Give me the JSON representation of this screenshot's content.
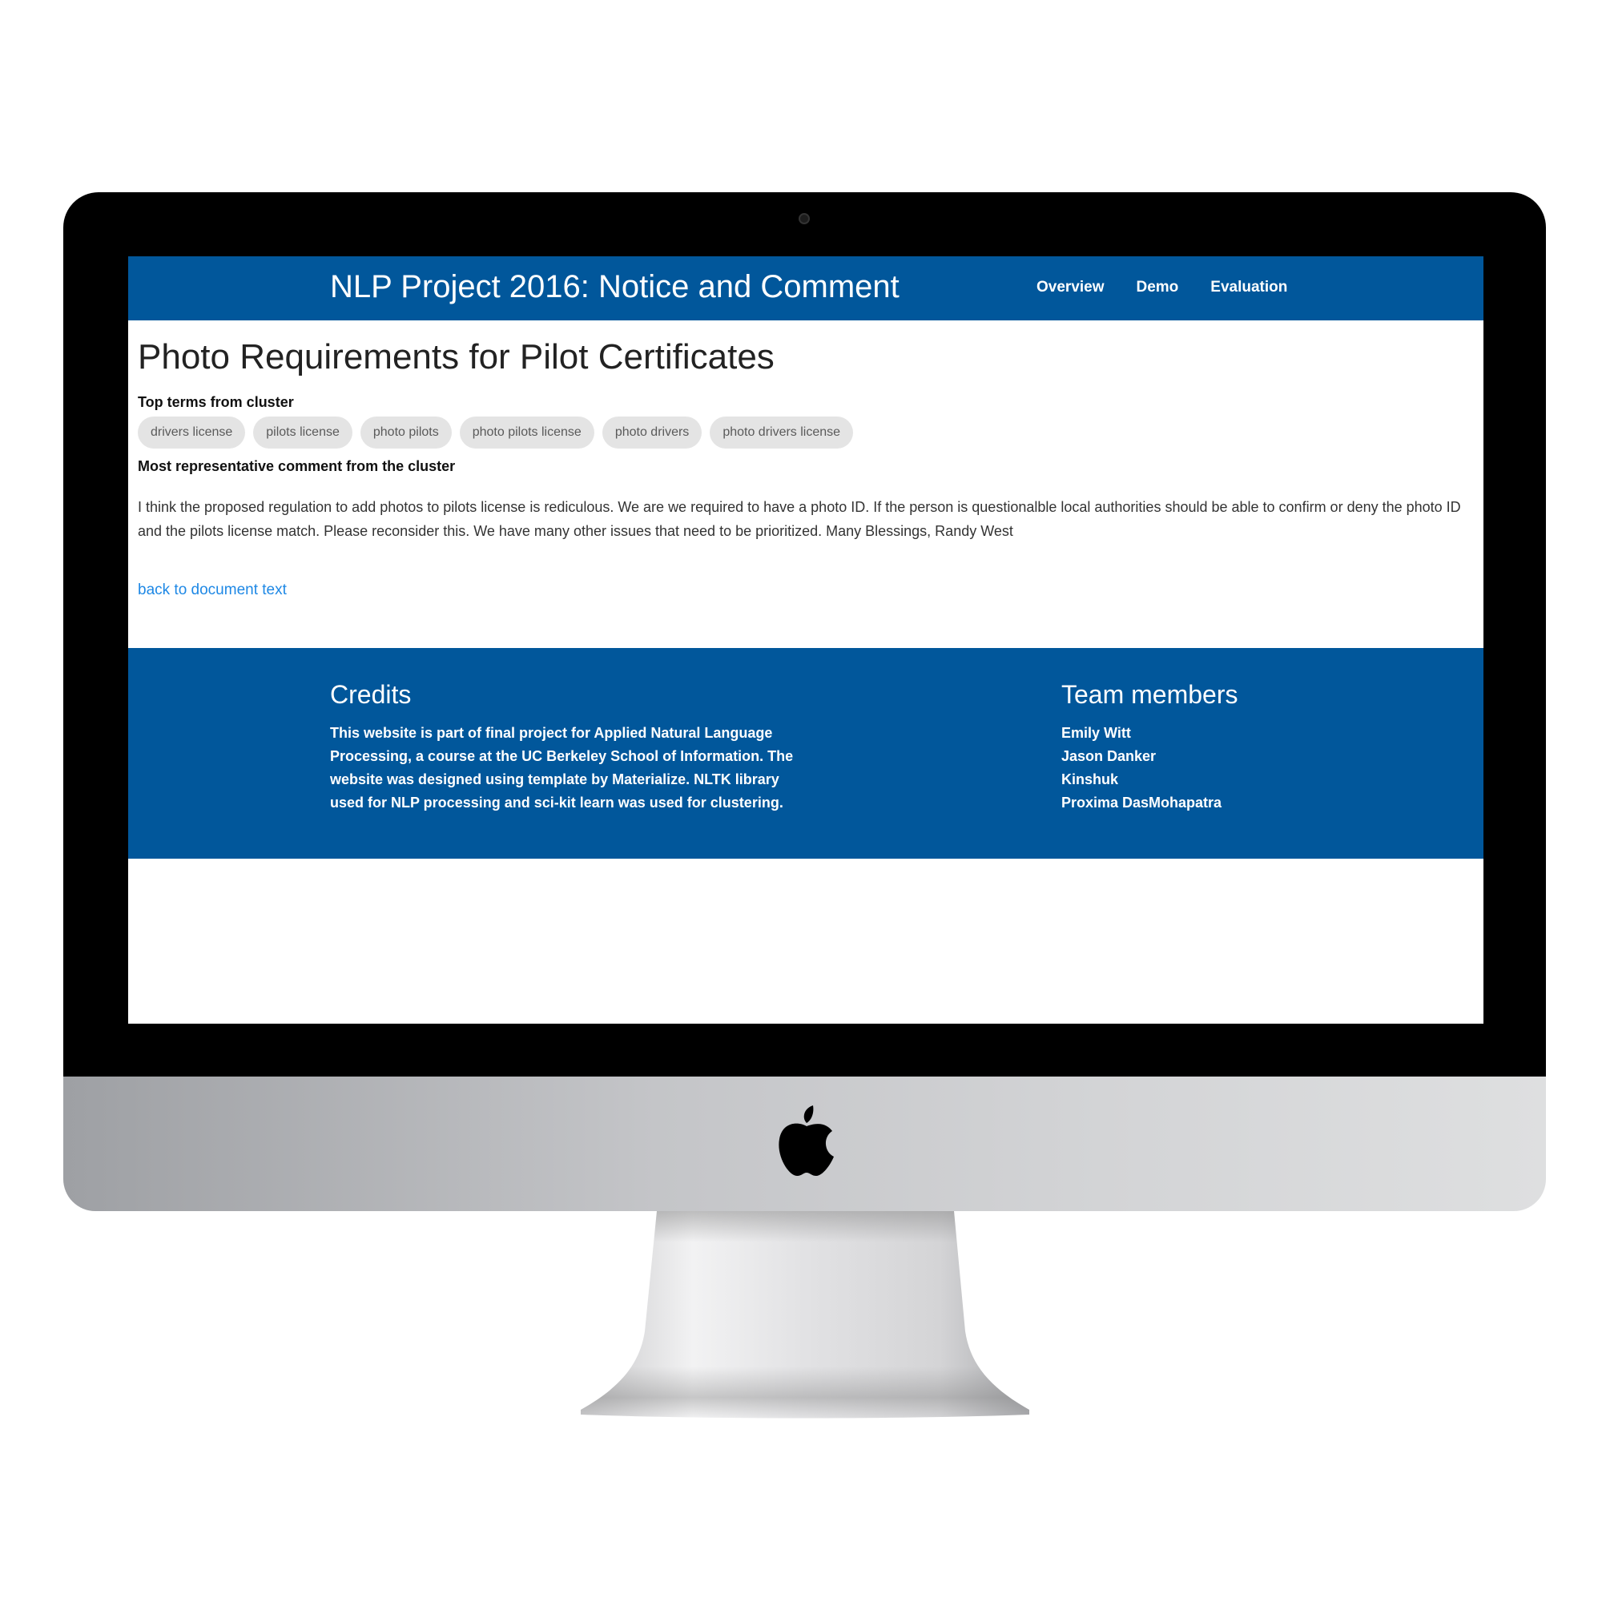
{
  "header": {
    "brand": "NLP Project 2016: Notice and Comment",
    "nav": [
      "Overview",
      "Demo",
      "Evaluation"
    ]
  },
  "main": {
    "title": "Photo Requirements for Pilot Certificates",
    "terms_label": "Top terms from cluster",
    "terms": [
      "drivers license",
      "pilots license",
      "photo pilots",
      "photo pilots license",
      "photo drivers",
      "photo drivers license"
    ],
    "comment_label": "Most representative comment from the cluster",
    "comment": "I think the proposed regulation to add photos to pilots license is rediculous. We are we required to have a photo ID. If the person is questionalble local authorities should be able to confirm or deny the photo ID and the pilots license match. Please reconsider this. We have many other issues that need to be prioritized. Many Blessings, Randy West",
    "back_link": "back to document text"
  },
  "footer": {
    "credits_title": "Credits",
    "credits_text": "This website is part of final project for Applied Natural Language Processing, a course at the UC Berkeley School of Information. The website was designed using template by Materialize. NLTK library used for NLP processing and sci-kit learn was used for clustering.",
    "team_title": "Team members",
    "team": [
      "Emily Witt",
      "Jason Danker",
      "Kinshuk",
      "Proxima DasMohapatra"
    ]
  },
  "device": {
    "logo_icon": "apple-logo-icon",
    "colors": {
      "primary": "#01579b",
      "link": "#1e88e5",
      "chip": "#e4e4e4"
    }
  }
}
